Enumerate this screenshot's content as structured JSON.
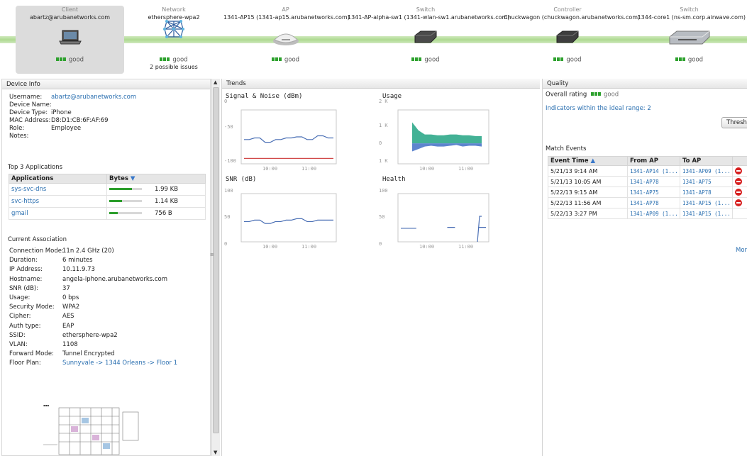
{
  "topology": {
    "client": {
      "caption": "Client",
      "name": "abartz@arubanetworks.com",
      "status": "good"
    },
    "network": {
      "caption": "Network",
      "name": "ethersphere-wpa2",
      "status": "good",
      "issues": "2 possible issues"
    },
    "ap": {
      "caption": "AP",
      "name": "1341-AP15 (1341-ap15.arubanetworks.com)",
      "status": "good"
    },
    "switch1": {
      "caption": "Switch",
      "name": "1341-AP-alpha-sw1 (1341-wlan-sw1.arubanetworks.com)",
      "status": "good"
    },
    "controller": {
      "caption": "Controller",
      "name": "Chuckwagon (chuckwagon.arubanetworks.com)",
      "status": "good"
    },
    "switch2": {
      "caption": "Switch",
      "name": "1344-core1 (ns-sm.corp.airwave.com)",
      "status": "good"
    }
  },
  "device_info": {
    "title": "Device Info",
    "rows": [
      {
        "label": "Username:",
        "value": "abartz@arubanetworks.com"
      },
      {
        "label": "Device Name:",
        "value": ""
      },
      {
        "label": "Device Type:",
        "value": "iPhone"
      },
      {
        "label": "MAC Address:",
        "value": "D8:D1:CB:6F:AF:69"
      },
      {
        "label": "Role:",
        "value": "Employee"
      },
      {
        "label": "Notes:",
        "value": ""
      }
    ]
  },
  "top_apps": {
    "title": "Top 3 Applications",
    "col_app": "Applications",
    "col_bytes": "Bytes",
    "rows": [
      {
        "name": "sys-svc-dns",
        "bytes": "1.99 KB",
        "fill": 0.7
      },
      {
        "name": "svc-https",
        "bytes": "1.14 KB",
        "fill": 0.4
      },
      {
        "name": "gmail",
        "bytes": "756 B",
        "fill": 0.25
      }
    ]
  },
  "association": {
    "title": "Current Association",
    "rows": [
      {
        "label": "Connection Mode:",
        "value": "11n 2.4 GHz (20)"
      },
      {
        "label": "Duration:",
        "value": "6 minutes"
      },
      {
        "label": "IP Address:",
        "value": "10.11.9.73"
      },
      {
        "label": "Hostname:",
        "value": "angela-iphone.arubanetworks.com"
      },
      {
        "label": "SNR (dB):",
        "value": "37"
      },
      {
        "label": "Usage:",
        "value": "0 bps"
      },
      {
        "label": "Security Mode:",
        "value": "WPA2"
      },
      {
        "label": "Cipher:",
        "value": "AES"
      },
      {
        "label": "Auth type:",
        "value": "EAP"
      },
      {
        "label": "SSID:",
        "value": "ethersphere-wpa2"
      },
      {
        "label": "VLAN:",
        "value": "1108"
      },
      {
        "label": "Forward Mode:",
        "value": "Tunnel Encrypted"
      },
      {
        "label": "Floor Plan:",
        "value": "Sunnyvale -> 1344 Orleans -> Floor 1"
      }
    ]
  },
  "trends": {
    "title": "Trends",
    "x_ticks": [
      "10:00",
      "11:00"
    ]
  },
  "chart_data": [
    {
      "type": "line",
      "title": "Signal & Noise (dBm)",
      "ylim": [
        -100,
        0
      ],
      "yticks": [
        "0",
        "-50",
        "-100"
      ],
      "series": [
        {
          "color": "#4a6fb5",
          "values": [
            -55,
            -55,
            -52,
            -52,
            -60,
            -60,
            -55,
            -55,
            -52,
            -52,
            -50,
            -50,
            -55,
            -55,
            -48,
            -48,
            -52,
            -52
          ]
        },
        {
          "color": "#d14a4a",
          "values": [
            -90,
            -90,
            -90,
            -90,
            -90,
            -90,
            -90,
            -90,
            -90,
            -90,
            -90,
            -90,
            -90,
            -90,
            -90,
            -90,
            -90,
            -90
          ]
        }
      ]
    },
    {
      "type": "area",
      "title": "Usage",
      "yticks": [
        "2 K",
        "1 K",
        "0",
        "1 K"
      ],
      "series": [
        {
          "color": "#2fa88a",
          "values": [
            1.3,
            0.8,
            0.55,
            0.55,
            0.5,
            0.5,
            0.55,
            0.55,
            0.5,
            0.5,
            0.45,
            0.45
          ]
        },
        {
          "color": "#4d78c9",
          "values": [
            -0.5,
            -0.35,
            -0.2,
            -0.15,
            -0.2,
            -0.2,
            -0.15,
            -0.1,
            -0.2,
            -0.15,
            -0.15,
            -0.2
          ]
        }
      ]
    },
    {
      "type": "line",
      "title": "SNR (dB)",
      "ylim": [
        0,
        100
      ],
      "yticks": [
        "100",
        "50",
        "0"
      ],
      "series": [
        {
          "color": "#4a6fb5",
          "values": [
            42,
            42,
            45,
            45,
            38,
            38,
            42,
            42,
            45,
            45,
            48,
            48,
            42,
            42,
            45,
            45,
            45,
            45
          ]
        }
      ]
    },
    {
      "type": "line",
      "title": "Health",
      "ylim": [
        0,
        100
      ],
      "yticks": [
        "100",
        "50",
        "0"
      ],
      "series": [
        {
          "color": "#4a6fb5",
          "values": [
            28,
            28,
            28,
            null,
            null,
            null,
            30,
            30,
            null,
            null,
            30,
            30
          ]
        }
      ]
    }
  ],
  "quality": {
    "title": "Quality",
    "overall_label": "Overall rating",
    "overall_value": "good",
    "indicators": "Indicators within the ideal range: 2",
    "thresholds_button": "Thresholds"
  },
  "match_events": {
    "title": "Match Events",
    "col_time": "Event Time",
    "col_from": "From AP",
    "col_to": "To AP",
    "rows": [
      {
        "time": "5/21/13 9:14 AM",
        "from": "1341-AP14 (1...",
        "to": "1341-AP09 (1...",
        "bad": true
      },
      {
        "time": "5/21/13 10:05 AM",
        "from": "1341-AP78",
        "to": "1341-AP75",
        "bad": true
      },
      {
        "time": "5/22/13 9:15 AM",
        "from": "1341-AP75",
        "to": "1341-AP78",
        "bad": true
      },
      {
        "time": "5/22/13 11:56 AM",
        "from": "1341-AP78",
        "to": "1341-AP15 (1...",
        "bad": true
      },
      {
        "time": "5/22/13 3:27 PM",
        "from": "1341-AP09 (1...",
        "to": "1341-AP15 (1...",
        "bad": false
      }
    ],
    "more": "Mor"
  }
}
